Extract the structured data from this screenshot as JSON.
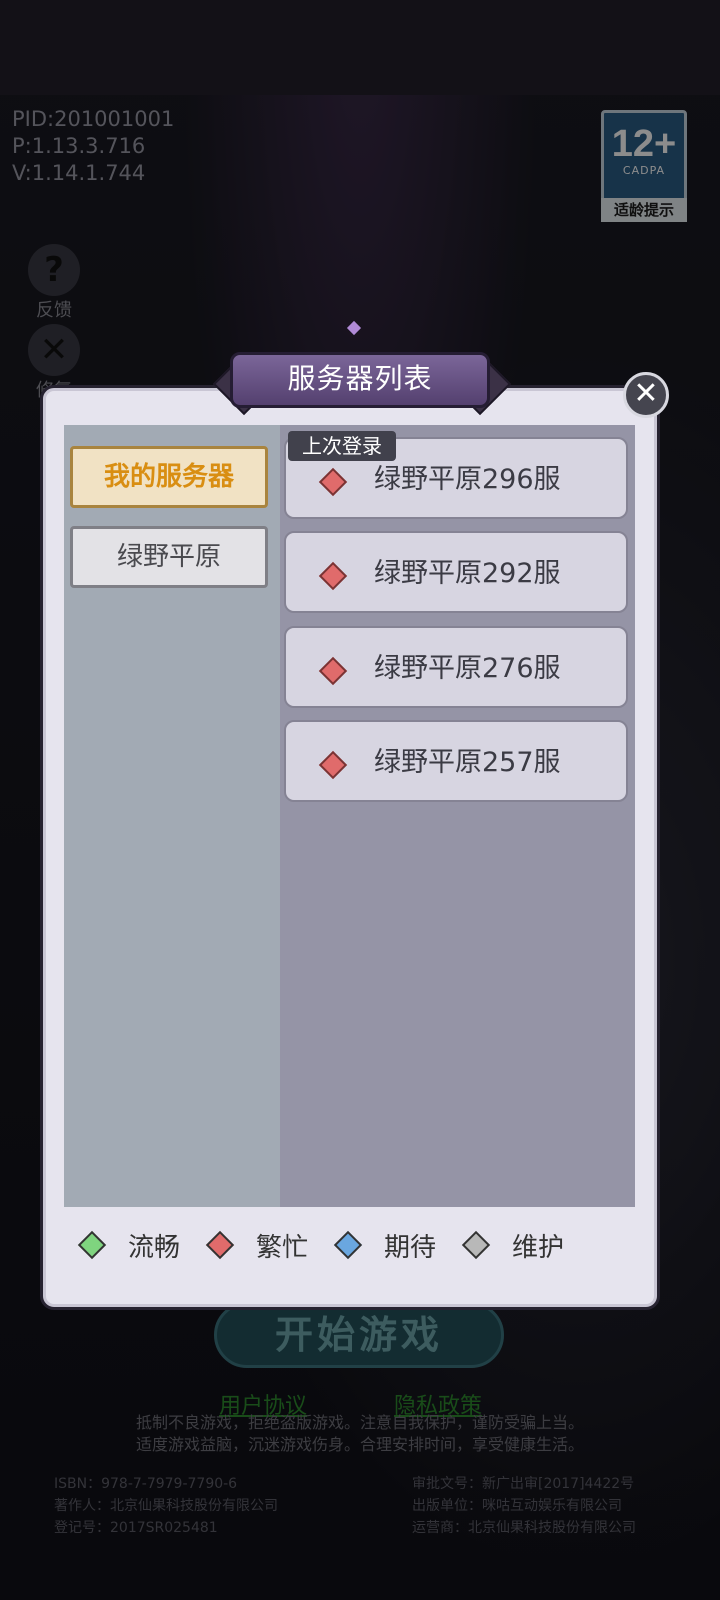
{
  "version": {
    "pid": "PID:201001001",
    "p": "P:1.13.3.716",
    "v": "V:1.14.1.744"
  },
  "age_rating": {
    "number": "12+",
    "org": "CADPA",
    "tip": "适龄提示"
  },
  "side_buttons": {
    "feedback": {
      "icon": "question-icon",
      "label": "反馈"
    },
    "repair": {
      "icon": "tools-icon",
      "label": "修复"
    }
  },
  "dialog": {
    "title": "服务器列表",
    "close_icon": "close-icon",
    "tabs": [
      {
        "label": "我的服务器",
        "active": true
      },
      {
        "label": "绿野平原",
        "active": false
      }
    ],
    "last_login_tag": "上次登录",
    "servers": [
      {
        "name": "绿野平原296服",
        "status": "busy"
      },
      {
        "name": "绿野平原292服",
        "status": "busy"
      },
      {
        "name": "绿野平原276服",
        "status": "busy"
      },
      {
        "name": "绿野平原257服",
        "status": "busy"
      }
    ],
    "legend": [
      {
        "label": "流畅",
        "color": "#7fd47f"
      },
      {
        "label": "繁忙",
        "color": "#e06b6b"
      },
      {
        "label": "期待",
        "color": "#6aa7e0"
      },
      {
        "label": "维护",
        "color": "#b8b8b8"
      }
    ]
  },
  "start_button": "开始游戏",
  "links": {
    "user_agreement": "用户协议",
    "privacy_policy": "隐私政策"
  },
  "notice": {
    "line1": "抵制不良游戏，拒绝盗版游戏。注意自我保护，谨防受骗上当。",
    "line2": "适度游戏益脑，沉迷游戏伤身。合理安排时间，享受健康生活。"
  },
  "legal": {
    "isbn": "ISBN：978-7-7979-7790-6",
    "author": "著作人：北京仙果科技股份有限公司",
    "registration": "登记号：2017SR025481",
    "approval": "审批文号：新广出审[2017]4422号",
    "publisher": "出版单位：咪咕互动娱乐有限公司",
    "operator": "运营商：北京仙果科技股份有限公司"
  }
}
